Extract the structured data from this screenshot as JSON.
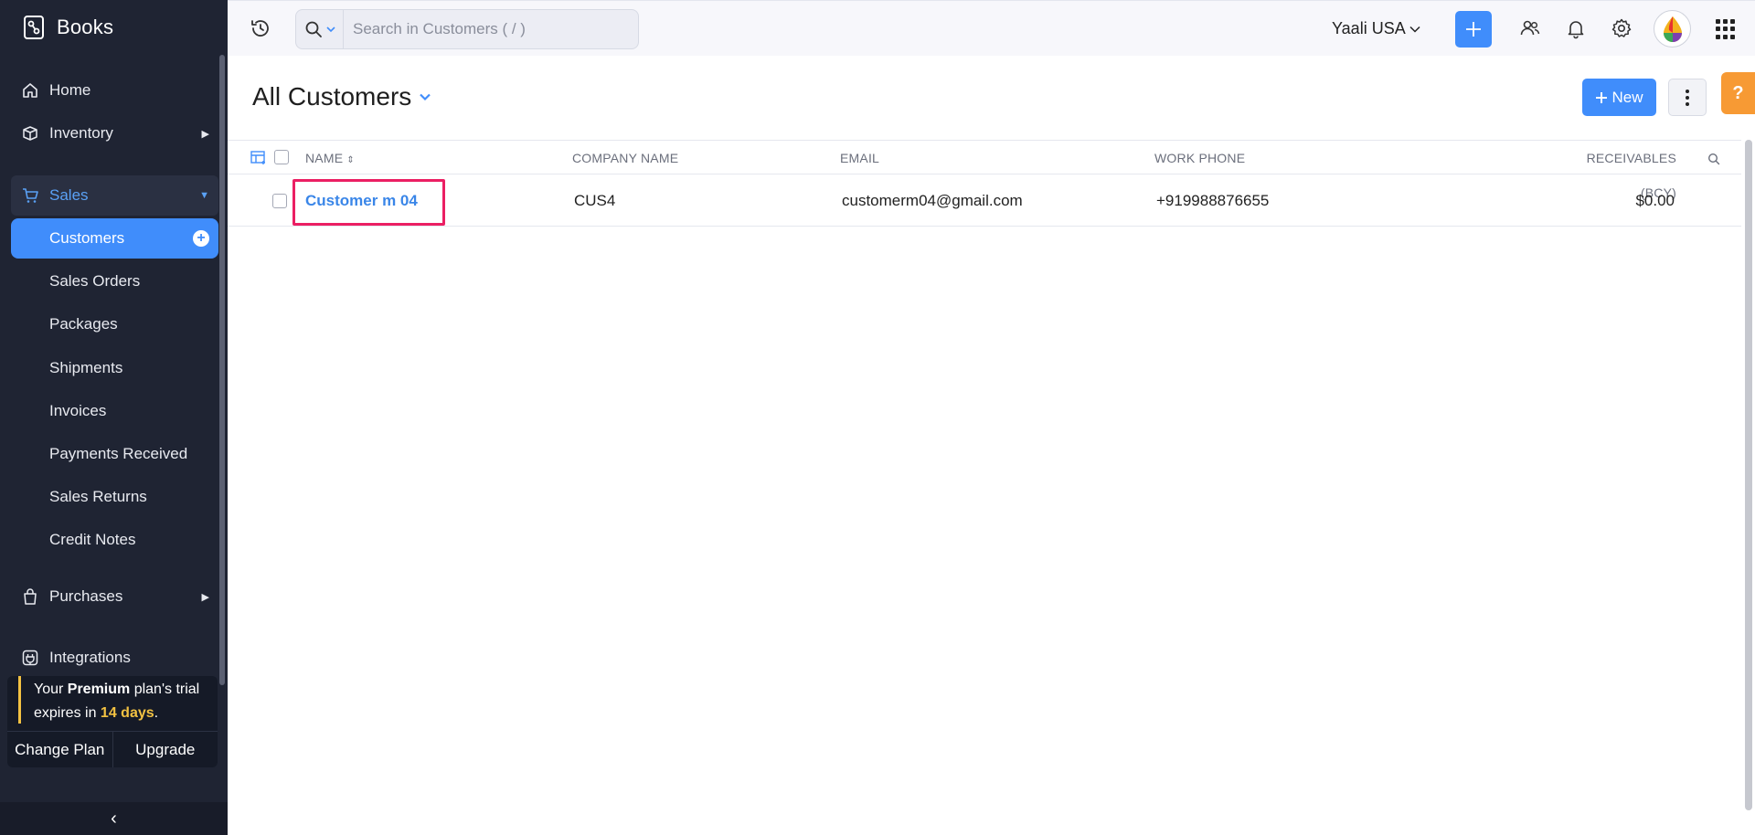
{
  "app": {
    "name": "Books"
  },
  "sidebar": {
    "items": [
      {
        "label": "Home",
        "icon": "home-icon"
      },
      {
        "label": "Inventory",
        "icon": "box-icon"
      },
      {
        "label": "Sales",
        "icon": "cart-icon"
      },
      {
        "label": "Purchases",
        "icon": "bag-icon"
      },
      {
        "label": "Integrations",
        "icon": "plug-icon"
      }
    ],
    "sales_sub": [
      {
        "label": "Customers",
        "active": true
      },
      {
        "label": "Sales Orders"
      },
      {
        "label": "Packages"
      },
      {
        "label": "Shipments"
      },
      {
        "label": "Invoices"
      },
      {
        "label": "Payments Received"
      },
      {
        "label": "Sales Returns"
      },
      {
        "label": "Credit Notes"
      }
    ],
    "trial": {
      "prefix": "Your ",
      "plan": "Premium",
      "middle": " plan's trial expires in ",
      "days": "14 days",
      "suffix": "."
    },
    "change_plan": "Change Plan",
    "upgrade": "Upgrade",
    "collapse": "‹"
  },
  "topbar": {
    "search_placeholder": "Search in Customers ( / )",
    "org_name": "Yaali USA",
    "accent": "#408dfb"
  },
  "page": {
    "title": "All Customers",
    "new_label": "New",
    "help_label": "?"
  },
  "table": {
    "headers": {
      "name": "NAME",
      "company": "COMPANY NAME",
      "email": "EMAIL",
      "phone": "WORK PHONE",
      "receivables": "RECEIVABLES (BCY)"
    },
    "rows": [
      {
        "name": "Customer m 04",
        "company": "CUS4",
        "email": "customerm04@gmail.com",
        "phone": "+919988876655",
        "receivables": "$0.00"
      }
    ]
  },
  "colors": {
    "sidebar_bg": "#1f2433",
    "highlight": "#eb1f63",
    "help": "#f79a34",
    "trial_accent": "#f3c242"
  }
}
